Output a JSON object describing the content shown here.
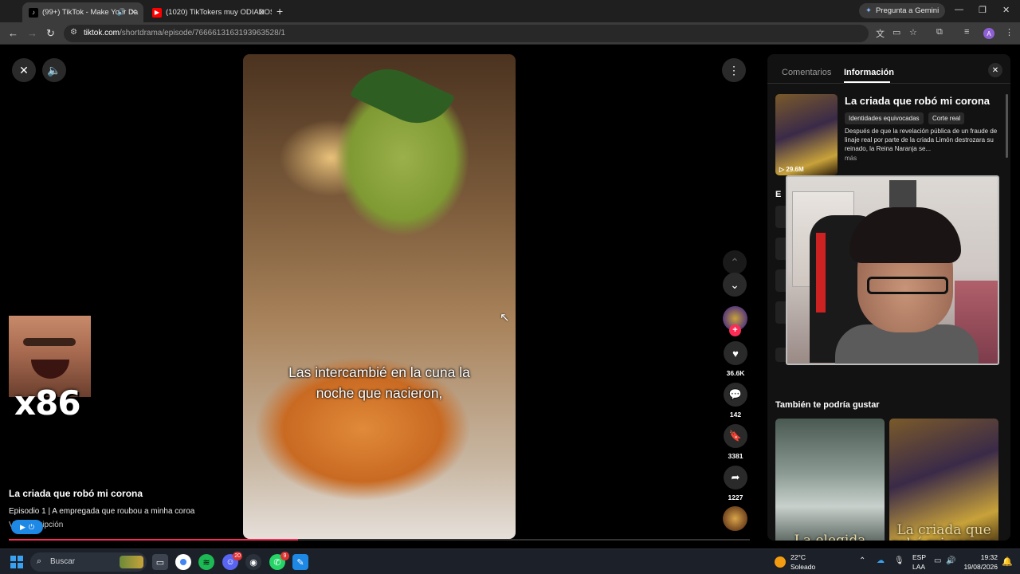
{
  "browser": {
    "tabs": [
      {
        "title": "(99+) TikTok - Make Your Da",
        "active": true,
        "icon": "tiktok-icon",
        "audio": true
      },
      {
        "title": "(1020) TikTokers muy ODIADOS",
        "active": false,
        "icon": "youtube-icon"
      }
    ],
    "new_tab_glyph": "+",
    "gemini_label": "Pregunta a Gemini",
    "window_controls": {
      "minimize": "—",
      "restore": "❐",
      "close": "✕"
    },
    "url_host": "tiktok.com",
    "url_path": "/shortdrama/episode/7666613163193963528/1",
    "profile_initial": "A"
  },
  "player": {
    "subtitle": "Las intercambié en la cuna la noche que nacieron,",
    "show_title": "La criada que robó mi corona",
    "episode": "Episodio 1 | A empregada que roubou a minha coroa",
    "see_more": "Ver descripción",
    "progress_fraction": 0.39,
    "actions": {
      "likes": "36.6K",
      "comments": "142",
      "saves": "3381",
      "shares": "1227"
    }
  },
  "overlay": {
    "count_label": "x86"
  },
  "panel": {
    "tabs": [
      "Comentarios",
      "Información"
    ],
    "active_tab": "Información",
    "poster_views": "▷ 29.6M",
    "show_name": "La criada que robó mi corona",
    "tags": [
      "Identidades equivocadas",
      "Corte real"
    ],
    "synopsis": "Después de que la revelación pública de un fraude de linaje real por parte de la criada Limón destrozara su reinado, la Reina Naranja se...",
    "more_label": "más",
    "episodes_heading": "E",
    "recommend_heading": "También te podría gustar",
    "recommendations": [
      {
        "title": "La elegida"
      },
      {
        "title": "La criada que robó mi corona"
      }
    ]
  },
  "taskbar": {
    "search_placeholder": "Buscar",
    "discord_badge": "20",
    "whatsapp_badge": "9",
    "weather_temp": "22°C",
    "weather_desc": "Soleado",
    "lang_line1": "ESP",
    "lang_line2": "LAA",
    "time": "19:32",
    "date": "19/08/2026"
  },
  "colors": {
    "accent": "#fe2c55",
    "panel_bg": "#121212",
    "chrome_bg": "#3c3c3c"
  }
}
